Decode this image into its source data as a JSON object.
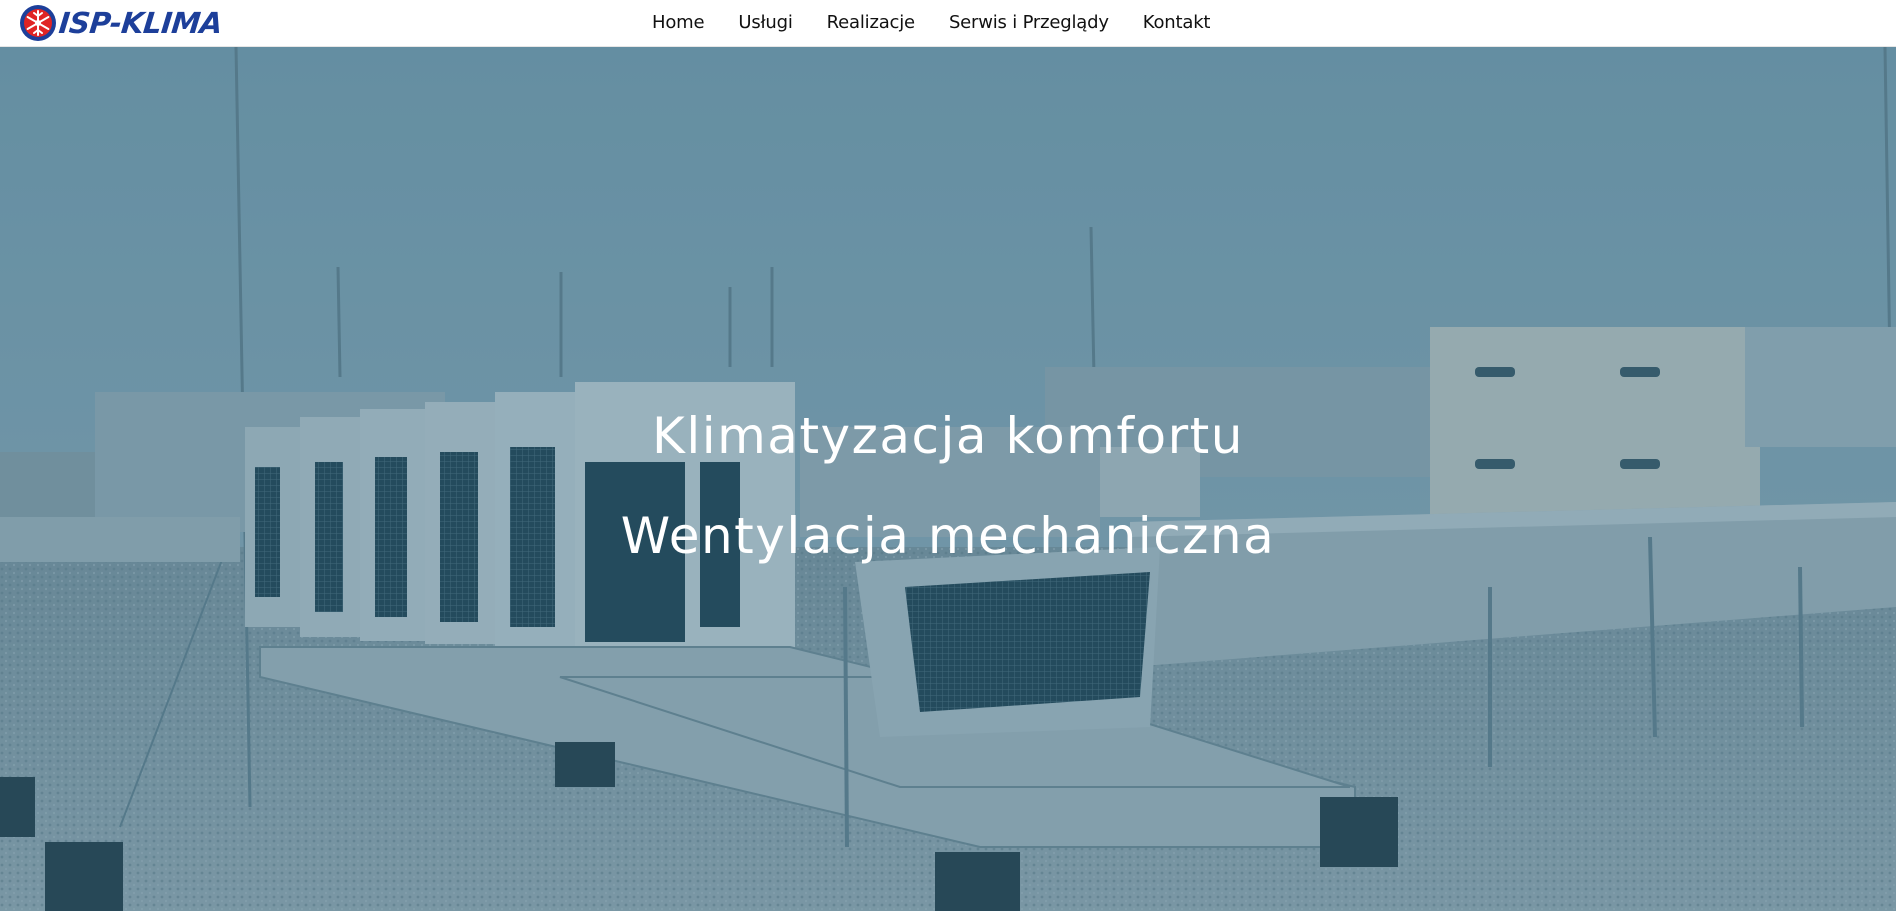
{
  "brand": {
    "name": "ISP-KLIMA",
    "colors": {
      "blue": "#1d3f9a",
      "red": "#e02424"
    }
  },
  "nav": {
    "items": [
      {
        "label": "Home"
      },
      {
        "label": "Usługi"
      },
      {
        "label": "Realizacje"
      },
      {
        "label": "Serwis i Przeglądy"
      },
      {
        "label": "Kontakt"
      }
    ]
  },
  "hero": {
    "heading_primary": "Klimatyzacja komfortu",
    "heading_secondary": "Wentylacja mechaniczna",
    "overlay_color": "#2d647d",
    "background_image": "rooftop-hvac-units"
  }
}
